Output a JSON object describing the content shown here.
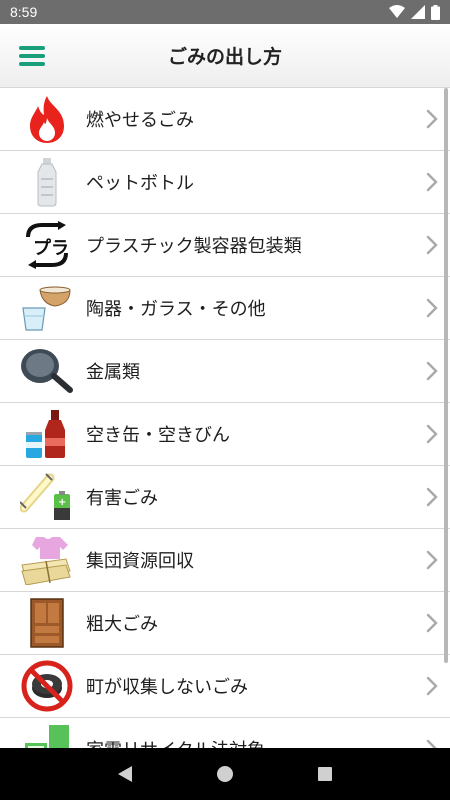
{
  "status_bar": {
    "time": "8:59"
  },
  "header": {
    "title": "ごみの出し方"
  },
  "accent_color": "#19a07a",
  "items": [
    {
      "label": "燃やせるごみ",
      "icon": "fire-icon"
    },
    {
      "label": "ペットボトル",
      "icon": "plastic-bottle-icon"
    },
    {
      "label": "プラスチック製容器包装類",
      "icon": "plastic-recycle-icon"
    },
    {
      "label": "陶器・ガラス・その他",
      "icon": "bowl-glass-icon"
    },
    {
      "label": "金属類",
      "icon": "frying-pan-icon"
    },
    {
      "label": "空き缶・空きびん",
      "icon": "can-bottle-icon"
    },
    {
      "label": "有害ごみ",
      "icon": "fluorescent-battery-icon"
    },
    {
      "label": "集団資源回収",
      "icon": "clothes-newspaper-icon"
    },
    {
      "label": "粗大ごみ",
      "icon": "cabinet-icon"
    },
    {
      "label": "町が収集しないごみ",
      "icon": "no-tire-icon"
    },
    {
      "label": "家電リサイクル法対象",
      "icon": "appliance-icon"
    }
  ]
}
